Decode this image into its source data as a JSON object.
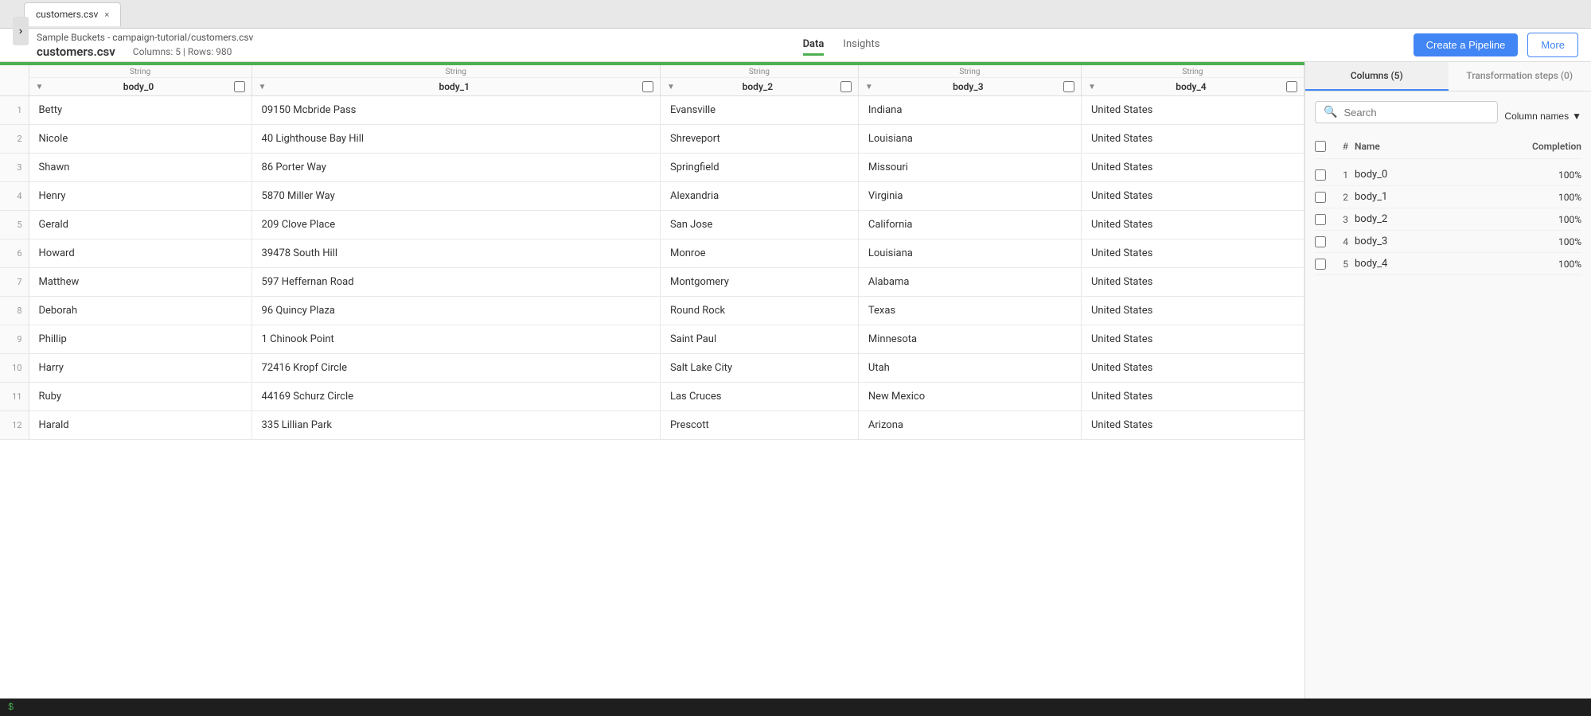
{
  "tab": {
    "label": "customers.csv",
    "close": "×"
  },
  "breadcrumb": "Sample Buckets - campaign-tutorial/customers.csv",
  "file": {
    "name": "customers.csv",
    "meta": "Columns: 5 | Rows: 980"
  },
  "nav": {
    "data_label": "Data",
    "insights_label": "Insights"
  },
  "actions": {
    "pipeline_label": "Create a Pipeline",
    "more_label": "More"
  },
  "columns": [
    {
      "type": "String",
      "name": "body_0"
    },
    {
      "type": "String",
      "name": "body_1"
    },
    {
      "type": "String",
      "name": "body_2"
    },
    {
      "type": "String",
      "name": "body_3"
    },
    {
      "type": "String",
      "name": "body_4"
    }
  ],
  "rows": [
    {
      "num": 1,
      "c0": "Betty",
      "c1": "09150 Mcbride Pass",
      "c2": "Evansville",
      "c3": "Indiana",
      "c4": "United States"
    },
    {
      "num": 2,
      "c0": "Nicole",
      "c1": "40 Lighthouse Bay Hill",
      "c2": "Shreveport",
      "c3": "Louisiana",
      "c4": "United States"
    },
    {
      "num": 3,
      "c0": "Shawn",
      "c1": "86 Porter Way",
      "c2": "Springfield",
      "c3": "Missouri",
      "c4": "United States"
    },
    {
      "num": 4,
      "c0": "Henry",
      "c1": "5870 Miller Way",
      "c2": "Alexandria",
      "c3": "Virginia",
      "c4": "United States"
    },
    {
      "num": 5,
      "c0": "Gerald",
      "c1": "209 Clove Place",
      "c2": "San Jose",
      "c3": "California",
      "c4": "United States"
    },
    {
      "num": 6,
      "c0": "Howard",
      "c1": "39478 South Hill",
      "c2": "Monroe",
      "c3": "Louisiana",
      "c4": "United States"
    },
    {
      "num": 7,
      "c0": "Matthew",
      "c1": "597 Heffernan Road",
      "c2": "Montgomery",
      "c3": "Alabama",
      "c4": "United States"
    },
    {
      "num": 8,
      "c0": "Deborah",
      "c1": "96 Quincy Plaza",
      "c2": "Round Rock",
      "c3": "Texas",
      "c4": "United States"
    },
    {
      "num": 9,
      "c0": "Phillip",
      "c1": "1 Chinook Point",
      "c2": "Saint Paul",
      "c3": "Minnesota",
      "c4": "United States"
    },
    {
      "num": 10,
      "c0": "Harry",
      "c1": "72416 Kropf Circle",
      "c2": "Salt Lake City",
      "c3": "Utah",
      "c4": "United States"
    },
    {
      "num": 11,
      "c0": "Ruby",
      "c1": "44169 Schurz Circle",
      "c2": "Las Cruces",
      "c3": "New Mexico",
      "c4": "United States"
    },
    {
      "num": 12,
      "c0": "Harald",
      "c1": "335 Lillian Park",
      "c2": "Prescott",
      "c3": "Arizona",
      "c4": "United States"
    }
  ],
  "right_panel": {
    "tab1_label": "Columns (5)",
    "tab2_label": "Transformation steps (0)",
    "search_placeholder": "Search",
    "column_names_label": "Column names",
    "header": {
      "num": "#",
      "name": "Name",
      "completion": "Completion"
    },
    "columns": [
      {
        "num": 1,
        "name": "body_0",
        "pct": "100%"
      },
      {
        "num": 2,
        "name": "body_1",
        "pct": "100%"
      },
      {
        "num": 3,
        "name": "body_2",
        "pct": "100%"
      },
      {
        "num": 4,
        "name": "body_3",
        "pct": "100%"
      },
      {
        "num": 5,
        "name": "body_4",
        "pct": "100%"
      }
    ]
  },
  "terminal": {
    "prompt": "$"
  }
}
